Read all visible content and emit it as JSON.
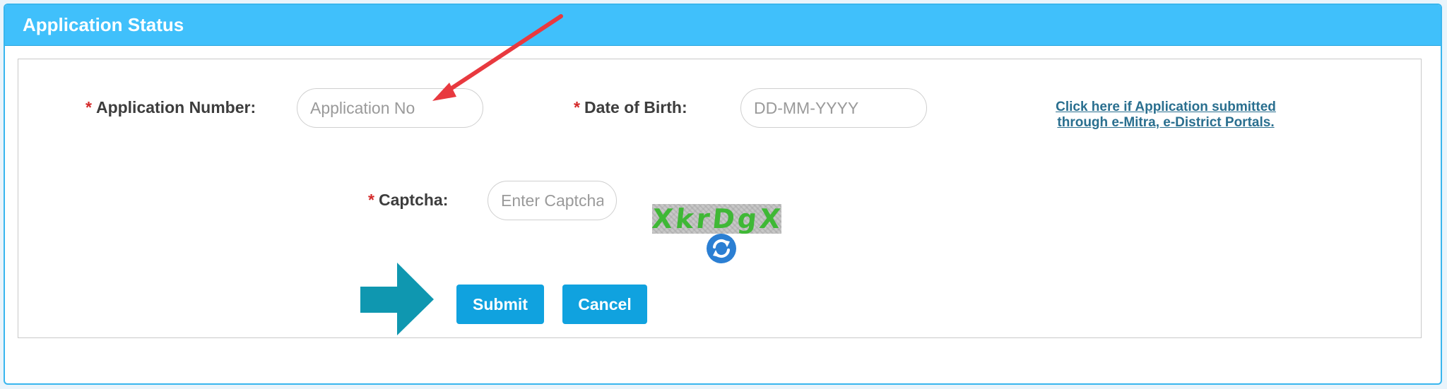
{
  "header": {
    "title": "Application Status"
  },
  "form": {
    "required_marker": "*",
    "application_number": {
      "label": "Application Number:",
      "placeholder": "Application No",
      "value": ""
    },
    "date_of_birth": {
      "label": "Date of Birth:",
      "placeholder": "DD-MM-YYYY",
      "value": ""
    },
    "captcha": {
      "label": "Captcha:",
      "placeholder": "Enter Captcha",
      "value": "",
      "image_text": "XkrDgX"
    },
    "emitra_link": {
      "line1": "Click here if Application submitted",
      "line2": "through e-Mitra, e-District Portals."
    },
    "submit_label": "Submit",
    "cancel_label": "Cancel"
  },
  "colors": {
    "header_bg": "#40c0fb",
    "button_bg": "#10a2df",
    "required": "#d42a2a",
    "link": "#2a6f8f",
    "annotation_arrow_red": "#e8393f",
    "annotation_arrow_teal": "#0f97b0"
  },
  "icons": {
    "refresh": "refresh-icon"
  }
}
